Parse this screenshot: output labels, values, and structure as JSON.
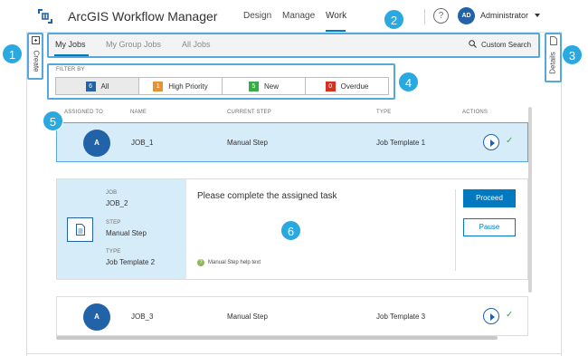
{
  "header": {
    "app_title": "ArcGIS Workflow Manager",
    "nav": [
      {
        "label": "Design"
      },
      {
        "label": "Manage"
      },
      {
        "label": "Work"
      }
    ],
    "active_nav": "Work",
    "help_glyph": "?",
    "user_initials": "AD",
    "user_name": "Administrator"
  },
  "sidebar_left": {
    "label": "Create"
  },
  "sidebar_right": {
    "label": "Details"
  },
  "tabs": [
    {
      "label": "My Jobs"
    },
    {
      "label": "My Group Jobs"
    },
    {
      "label": "All Jobs"
    }
  ],
  "active_tab": "My Jobs",
  "search": {
    "label": "Custom Search"
  },
  "filter": {
    "label": "FILTER BY",
    "options": [
      {
        "count": "6",
        "label": "All",
        "color": "#2162a8"
      },
      {
        "count": "1",
        "label": "High Priority",
        "color": "#e8912d"
      },
      {
        "count": "5",
        "label": "New",
        "color": "#35ac46"
      },
      {
        "count": "0",
        "label": "Overdue",
        "color": "#d83020"
      }
    ],
    "selected": "All"
  },
  "columns": [
    "ASSIGNED TO",
    "NAME",
    "CURRENT STEP",
    "TYPE",
    "ACTIONS"
  ],
  "jobs": [
    {
      "avatar": "A",
      "name": "JOB_1",
      "step": "Manual Step",
      "type": "Job Template 1"
    },
    {
      "avatar": "A",
      "name": "JOB_3",
      "step": "Manual Step",
      "type": "Job Template 3"
    }
  ],
  "detail": {
    "job_key": "JOB",
    "job_value": "JOB_2",
    "step_key": "STEP",
    "step_value": "Manual Step",
    "type_key": "TYPE",
    "type_value": "Job Template 2",
    "task_title": "Please complete the assigned task",
    "help_text": "Manual Step help text",
    "proceed_label": "Proceed",
    "pause_label": "Pause"
  },
  "check_glyph": "✓",
  "callouts": [
    "1",
    "2",
    "3",
    "4",
    "5",
    "6"
  ],
  "colors": {
    "accent": "#0079c1",
    "callout": "#2aa8e0",
    "selection": "#d7ecf9"
  }
}
